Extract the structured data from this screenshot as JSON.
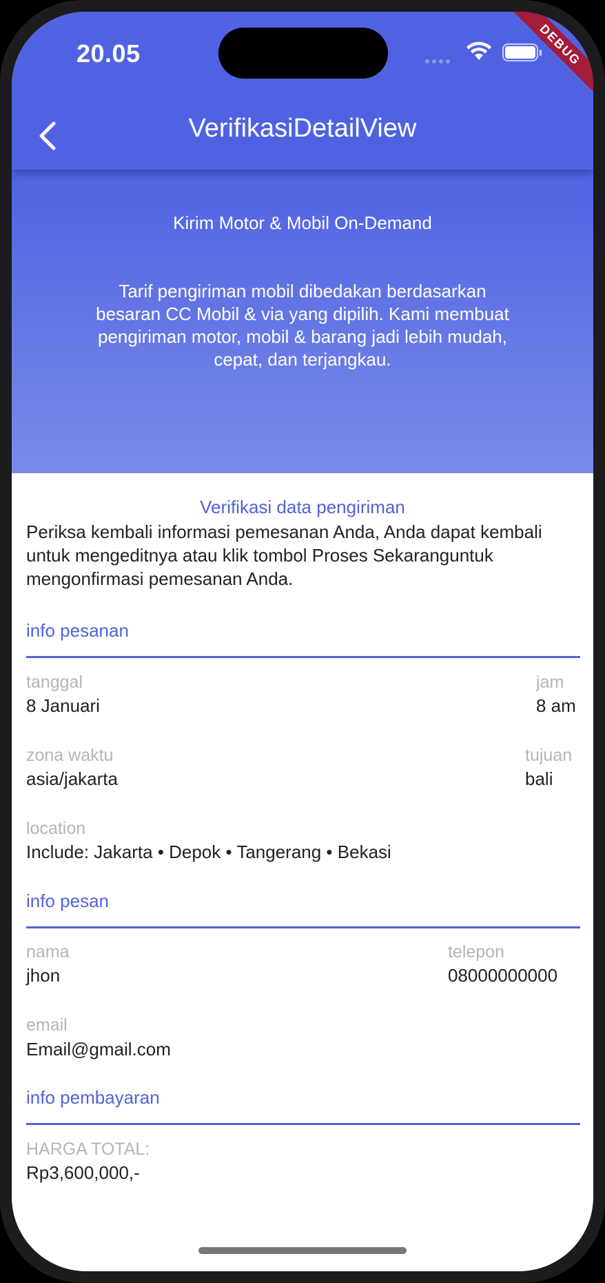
{
  "status_bar": {
    "time": "20.05",
    "debug_banner": "DEBUG"
  },
  "app_bar": {
    "title": "VerifikasiDetailView",
    "back_icon": "chevron-left-icon"
  },
  "hero": {
    "title": "Kirim Motor & Mobil On-Demand",
    "description": "Tarif pengiriman mobil dibedakan berdasarkan besaran CC Mobil & via yang dipilih. Kami membuat pengiriman motor, mobil & barang jadi lebih mudah, cepat, dan terjangkau."
  },
  "verification": {
    "title": "Verifikasi data pengiriman",
    "description": "Periksa kembali informasi pemesanan Anda, Anda dapat kembali untuk mengeditnya atau klik tombol Proses Sekaranguntuk mengonfirmasi pemesanan Anda."
  },
  "order_info": {
    "title": "info pesanan",
    "date_label": "tanggal",
    "date_value": "8 Januari",
    "time_label": "jam",
    "time_value": "8 am",
    "timezone_label": "zona waktu",
    "timezone_value": "asia/jakarta",
    "destination_label": "tujuan",
    "destination_value": "bali",
    "location_label": "location",
    "location_value": "Include: Jakarta • Depok • Tangerang • Bekasi"
  },
  "sender_info": {
    "title": "info pesan",
    "name_label": "nama",
    "name_value": "jhon",
    "phone_label": "telepon",
    "phone_value": "08000000000",
    "email_label": "email",
    "email_value": "Email@gmail.com"
  },
  "payment_info": {
    "title": "info pembayaran",
    "total_label": "HARGA TOTAL:",
    "total_value": "Rp3,600,000,-"
  },
  "colors": {
    "primary": "#4f63e2",
    "accent_text": "#5262d8",
    "debug": "#a31c3a"
  }
}
